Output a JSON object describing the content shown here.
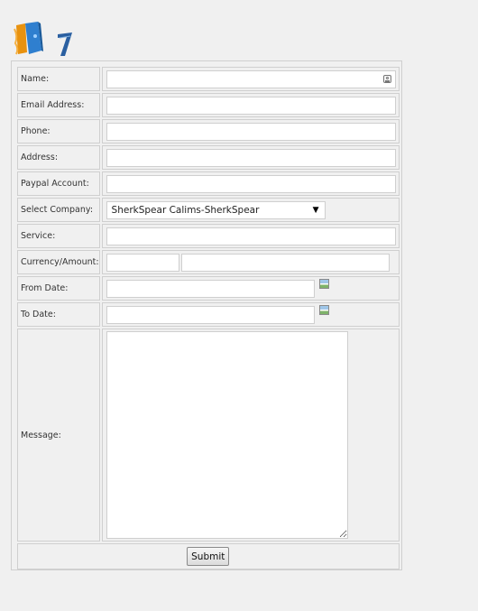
{
  "form": {
    "fields": {
      "name": {
        "label": "Name:",
        "value": ""
      },
      "email": {
        "label": "Email Address:",
        "value": ""
      },
      "phone": {
        "label": "Phone:",
        "value": ""
      },
      "address": {
        "label": "Address:",
        "value": ""
      },
      "paypal": {
        "label": "Paypal Account:",
        "value": ""
      },
      "company": {
        "label": "Select Company:",
        "selected": "SherkSpear Calims-SherkSpear"
      },
      "service": {
        "label": "Service:",
        "value": ""
      },
      "currency": {
        "label": "Currency/Amount:",
        "code_value": "",
        "amount_value": ""
      },
      "from_date": {
        "label": "From Date:",
        "value": ""
      },
      "to_date": {
        "label": "To Date:",
        "value": ""
      },
      "message": {
        "label": "Message:",
        "value": ""
      }
    },
    "submit_label": "Submit"
  },
  "icons": {
    "logo": "books-logo-icon",
    "name_field_badge": "contact-card-icon",
    "date_picker": "calendar-icon"
  },
  "colors": {
    "background": "#f0f0f0",
    "border": "#cfcfcf",
    "logo_orange": "#f39c12",
    "logo_blue": "#2f7fcf"
  }
}
